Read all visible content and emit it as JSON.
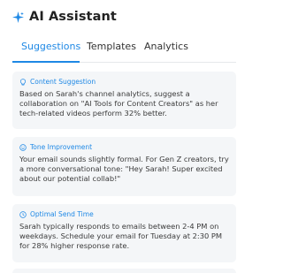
{
  "header": {
    "title": "AI Assistant",
    "icon": "sparkle-icon"
  },
  "tabs": [
    {
      "label": "Suggestions",
      "active": true
    },
    {
      "label": "Templates",
      "active": false
    },
    {
      "label": "Analytics",
      "active": false
    }
  ],
  "cards": [
    {
      "icon": "lightbulb-icon",
      "label": "Content Suggestion",
      "text": "Based on Sarah's channel analytics, suggest a collaboration on \"AI Tools for Content Creators\" as her tech-related videos perform 32% better."
    },
    {
      "icon": "smile-icon",
      "label": "Tone Improvement",
      "text": "Your email sounds slightly formal. For Gen Z creators, try a more conversational tone: \"Hey Sarah! Super excited about our potential collab!\""
    },
    {
      "icon": "clock-icon",
      "label": "Optimal Send Time",
      "text": "Sarah typically responds to emails between 2-4 PM on weekdays. Schedule your email for Tuesday at 2:30 PM for 28% higher response rate."
    }
  ],
  "colors": {
    "accent": "#1e88e5",
    "card_bg": "#f4f6f8"
  }
}
